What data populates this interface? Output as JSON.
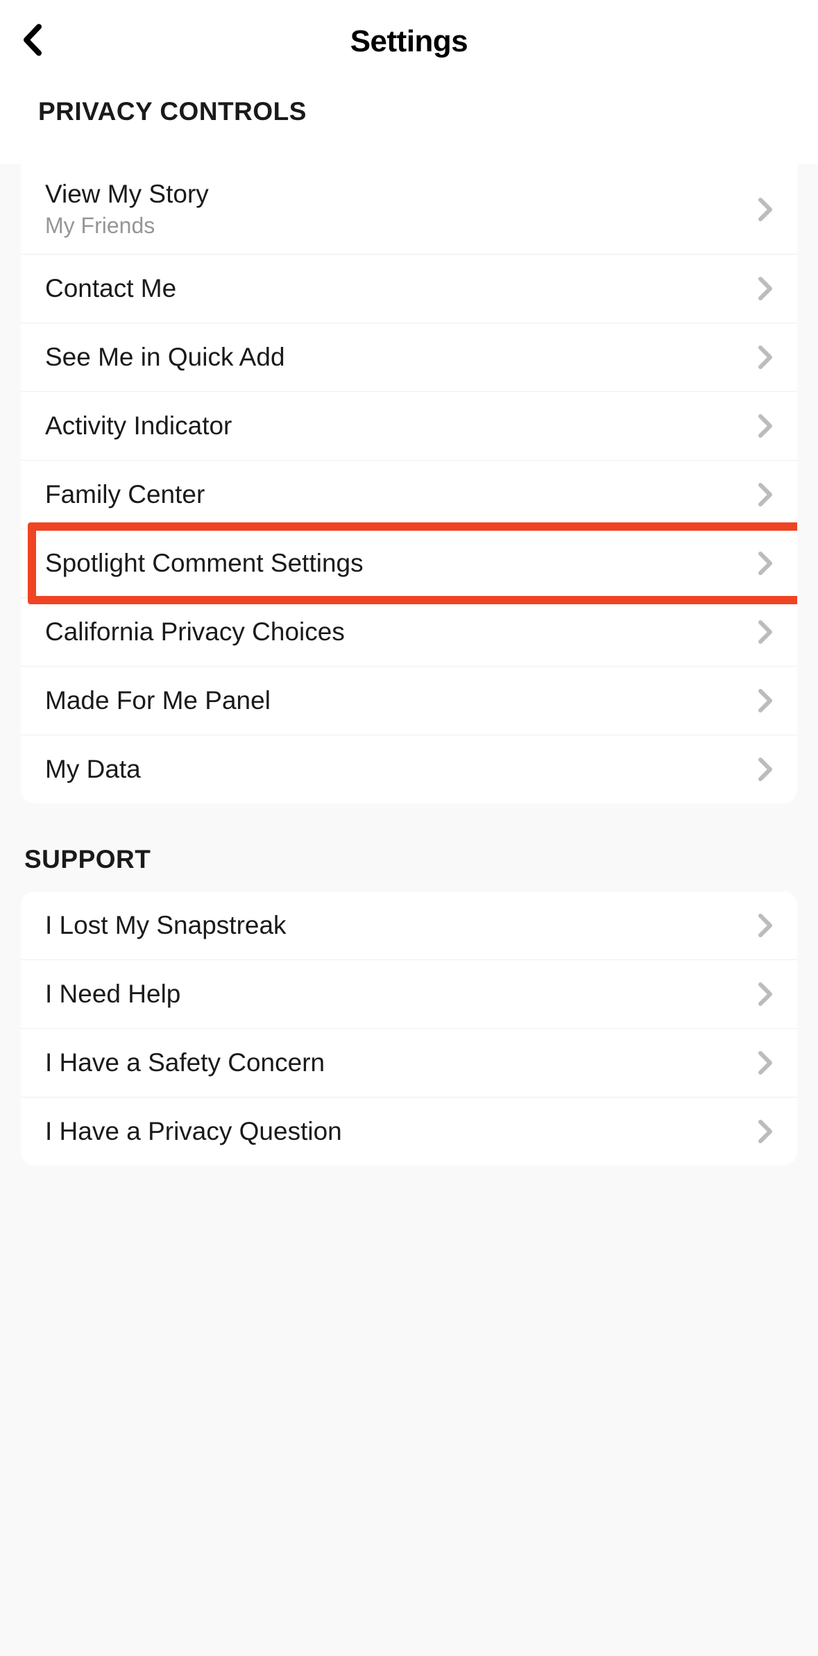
{
  "header": {
    "title": "Settings"
  },
  "sections": {
    "privacy_controls": {
      "title": "PRIVACY CONTROLS",
      "items": [
        {
          "title": "View My Story",
          "subtitle": "My Friends"
        },
        {
          "title": "Contact Me"
        },
        {
          "title": "See Me in Quick Add"
        },
        {
          "title": "Activity Indicator"
        },
        {
          "title": "Family Center"
        },
        {
          "title": "Spotlight Comment Settings",
          "highlighted": true
        },
        {
          "title": "California Privacy Choices"
        },
        {
          "title": "Made For Me Panel"
        },
        {
          "title": "My Data"
        }
      ]
    },
    "support": {
      "title": "SUPPORT",
      "items": [
        {
          "title": "I Lost My Snapstreak"
        },
        {
          "title": "I Need Help"
        },
        {
          "title": "I Have a Safety Concern"
        },
        {
          "title": "I Have a Privacy Question"
        }
      ]
    }
  }
}
